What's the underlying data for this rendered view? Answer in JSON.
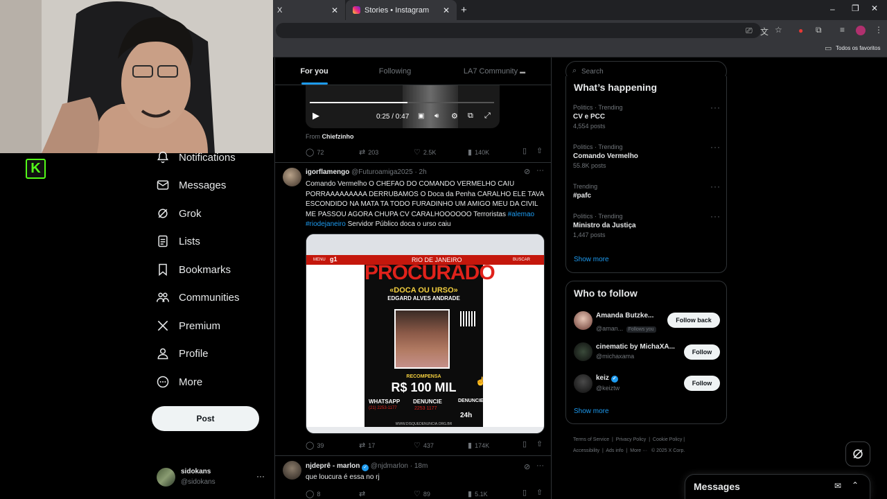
{
  "browser": {
    "tab1_title": "X",
    "tab2_title": "Stories • Instagram",
    "bookmark_folder": "Todos os favoritos",
    "icons": [
      "instagram-icon",
      "close-icon",
      "plus-icon",
      "minimize-icon",
      "maximize-icon",
      "extensions-icon",
      "star-icon",
      "profile-icon",
      "folder-icon"
    ]
  },
  "webcam": {
    "logo_letter": "K"
  },
  "nav": {
    "items": [
      {
        "label": "Notifications",
        "icon": "bell-icon"
      },
      {
        "label": "Messages",
        "icon": "mail-icon"
      },
      {
        "label": "Grok",
        "icon": "grok-icon"
      },
      {
        "label": "Lists",
        "icon": "list-icon"
      },
      {
        "label": "Bookmarks",
        "icon": "bookmark-icon"
      },
      {
        "label": "Communities",
        "icon": "communities-icon"
      },
      {
        "label": "Premium",
        "icon": "x-logo-icon"
      },
      {
        "label": "Profile",
        "icon": "person-icon"
      },
      {
        "label": "More",
        "icon": "more-circle-icon"
      }
    ],
    "post_label": "Post",
    "account": {
      "name": "sidokans",
      "handle": "@sidokans"
    }
  },
  "feed": {
    "tabs": [
      "For you",
      "Following",
      "LA7 Community"
    ],
    "active_tab": "For you",
    "video": {
      "time": "0:25 / 0:47",
      "progress": 0.53,
      "from_label": "From",
      "from_user": "Chiefzinho"
    },
    "post1_metrics": {
      "replies": "72",
      "reposts": "203",
      "likes": "2.5K",
      "views": "140K"
    },
    "post2": {
      "name": "igorflamengo",
      "handle": "@Futuroamiga2025",
      "time": "· 2h",
      "text": "Comando Vermelho O CHEFAO DO COMANDO VERMELHO CAIU PORRAAAAAAAAA DERRUBAMOS O Doca da Penha CARALHO ELE TAVA ESCONDIDO NA MATA TA TODO FURADINHO UM AMIGO MEU DA CIVIL ME PASSOU AGORA CHUPA CV CARALHOOOOOO Terroristas",
      "hashtag1": "#alemao",
      "hashtag2": "#riodejaneiro",
      "text_end": "Servidor Público doca o urso caiu",
      "metrics": {
        "replies": "39",
        "reposts": "17",
        "likes": "437",
        "views": "174K"
      },
      "poster": {
        "site_section": "RIO DE JANEIRO",
        "menu": "MENU",
        "brand": "g1",
        "search": "BUSCAR",
        "headline": "PROCURADO",
        "alias": "«DOCA OU URSO»",
        "name": "EDGARD ALVES ANDRADE",
        "reward_label": "RECOMPENSA",
        "reward": "R$ 100 MIL",
        "whatsapp": "WHATSAPP",
        "whatsapp_num": "(21) 2253-1177",
        "denuncie": "DENUNCIE",
        "denuncie_num": "2253 1177",
        "denuncie2": "DENUNCIE",
        "hours": "24h",
        "site": "WWW.DISQUEDENUNCIA.ORG.BR"
      }
    },
    "post3": {
      "name": "njdeprê - marlon",
      "handle": "@njdmarlon",
      "time": "· 18m",
      "text": "que loucura é essa no rj",
      "metrics": {
        "likes": "89",
        "views": "5.1K"
      }
    }
  },
  "right": {
    "search_placeholder": "Search",
    "happening_title": "What’s happening",
    "trends": [
      {
        "context": "Politics · Trending",
        "title": "CV e PCC",
        "posts": "4,554 posts"
      },
      {
        "context": "Politics · Trending",
        "title": "Comando Vermelho",
        "posts": "55.8K posts"
      },
      {
        "context": "Trending",
        "title": "#pafc",
        "posts": ""
      },
      {
        "context": "Politics · Trending",
        "title": "Ministro da Justiça",
        "posts": "1,447 posts"
      }
    ],
    "show_more": "Show more",
    "who_title": "Who to follow",
    "follow": [
      {
        "name": "Amanda Butzke...",
        "handle": "@aman...",
        "badge": "Follows you",
        "button": "Follow back"
      },
      {
        "name": "cinematic by MichaXA...",
        "handle": "@michaxama",
        "badge": "",
        "button": "Follow"
      },
      {
        "name": "keiz",
        "handle": "@keiztw",
        "badge": "",
        "button": "Follow"
      }
    ],
    "show_more2": "Show more",
    "footer": [
      "Terms of Service",
      "Privacy Policy",
      "Cookie Policy",
      "Accessibility",
      "Ads info",
      "More ···",
      "© 2025 X Corp."
    ],
    "messages_title": "Messages"
  }
}
